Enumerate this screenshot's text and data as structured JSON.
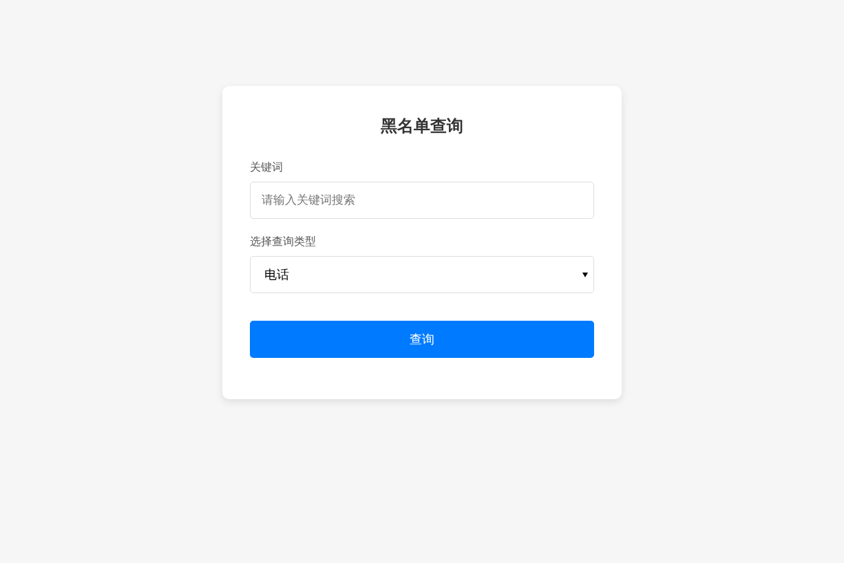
{
  "title": "黑名单查询",
  "keyword_field": {
    "label": "关键词",
    "placeholder": "请输入关键词搜索"
  },
  "type_select": {
    "label": "选择查询类型",
    "value": "电话"
  },
  "submit_button": {
    "label": "查询"
  }
}
